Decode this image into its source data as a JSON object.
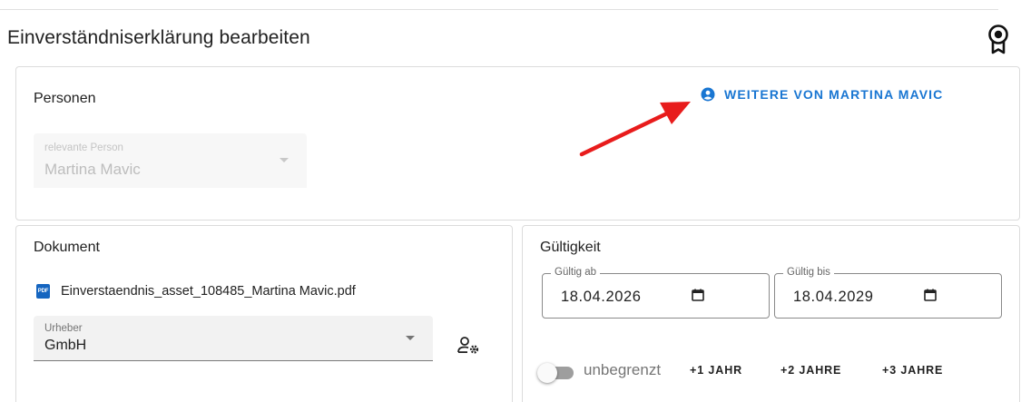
{
  "page": {
    "title": "Einverständniserklärung bearbeiten"
  },
  "icons": {
    "award": "award-badge-icon",
    "person": "account-circle-icon",
    "pdf": "pdf-file-icon",
    "user_settings": "user-settings-icon",
    "calendar": "calendar-icon"
  },
  "colors": {
    "accent": "#1976d2",
    "annotation_arrow": "#e81c1c"
  },
  "personen": {
    "title": "Personen",
    "more_button": "WEITERE VON MARTINA MAVIC",
    "person_select": {
      "label": "relevante Person",
      "value": "Martina Mavic",
      "disabled": true
    }
  },
  "dokument": {
    "title": "Dokument",
    "pdf_badge": "PDF",
    "file_name": "Einverstaendnis_asset_108485_Martina Mavic.pdf",
    "urheber_select": {
      "label": "Urheber",
      "value": "GmbH"
    }
  },
  "gueltigkeit": {
    "title": "Gültigkeit",
    "from": {
      "label": "Gültig ab",
      "value": "18.04.2026"
    },
    "to": {
      "label": "Gültig bis",
      "value": "18.04.2029"
    },
    "unlimited_label": "unbegrenzt",
    "unlimited_checked": false,
    "year_buttons": [
      "+1 JAHR",
      "+2 JAHRE",
      "+3 JAHRE"
    ]
  }
}
